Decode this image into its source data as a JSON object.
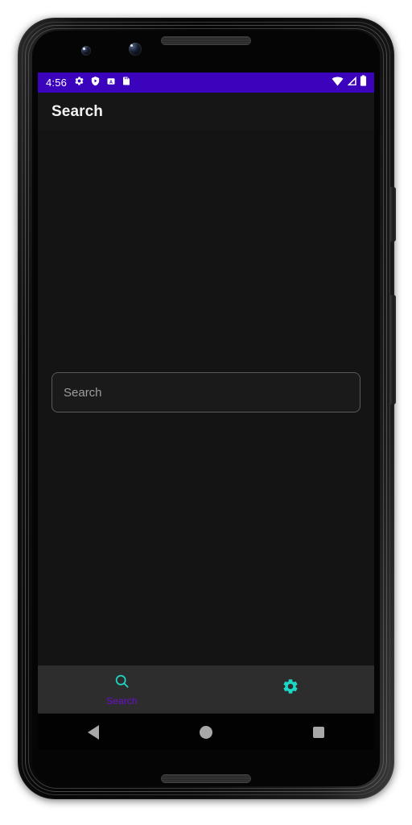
{
  "device": {
    "type": "android-phone-mockup",
    "hardware": {
      "earpiece": "earpiece-speaker",
      "front_camera_left": "camera-lens",
      "front_camera_right": "camera-lens",
      "bottom_speaker": "bottom-speaker",
      "power_button": "power-button",
      "volume_button": "volume-button"
    }
  },
  "status_bar": {
    "time": "4:56",
    "background_color": "#3c03bd",
    "foreground_color": "#ffffff",
    "left_icons": [
      {
        "name": "gear-icon",
        "label": "Settings"
      },
      {
        "name": "shield-play-icon",
        "label": "Protection"
      },
      {
        "name": "letter-a-box-icon",
        "label": "Accessibility"
      },
      {
        "name": "sd-card-icon",
        "label": "SD Card"
      }
    ],
    "right_icons": [
      {
        "name": "wifi-icon",
        "label": "Wi-Fi"
      },
      {
        "name": "cellular-signal-icon",
        "label": "Signal"
      },
      {
        "name": "battery-icon",
        "label": "Battery"
      }
    ]
  },
  "app_bar": {
    "title": "Search",
    "background_color": "#161616",
    "title_color": "#f2f2f2"
  },
  "main": {
    "background_color": "#141414",
    "search": {
      "placeholder": "Search",
      "value": "",
      "border_color": "#5a5a5a"
    }
  },
  "bottom_nav": {
    "background_color": "#2d2d2d",
    "accent_icon_color": "#1ed6c4",
    "accent_label_color": "#6b0fce",
    "tabs": [
      {
        "id": "search",
        "label": "Search",
        "icon": "search-icon",
        "selected": true,
        "has_label": true
      },
      {
        "id": "settings",
        "label": "",
        "icon": "gear-icon",
        "selected": false,
        "has_label": false
      }
    ]
  },
  "system_nav": {
    "background_color": "#020202",
    "buttons": [
      {
        "name": "back-button",
        "icon": "triangle-left-icon"
      },
      {
        "name": "home-button",
        "icon": "circle-icon"
      },
      {
        "name": "recents-button",
        "icon": "square-icon"
      }
    ]
  }
}
